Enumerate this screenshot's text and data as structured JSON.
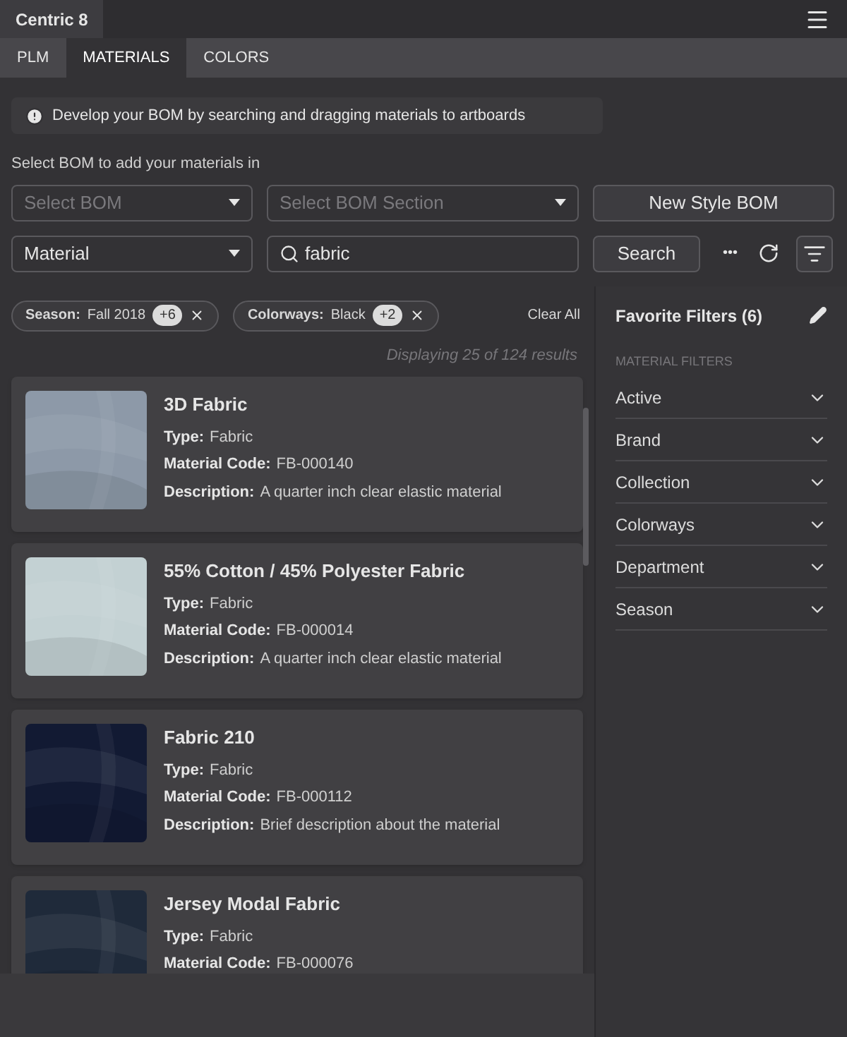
{
  "app": {
    "title": "Centric 8"
  },
  "tabs": [
    {
      "label": "PLM",
      "selected": false
    },
    {
      "label": "MATERIALS",
      "selected": true
    },
    {
      "label": "COLORS",
      "selected": false
    }
  ],
  "notice": "Develop your BOM by searching and dragging materials to artboards",
  "bom_label": "Select BOM to add your materials in",
  "bom_select": {
    "placeholder": "Select BOM"
  },
  "section_select": {
    "placeholder": "Select BOM Section"
  },
  "new_bom_button": "New Style BOM",
  "type_select": {
    "value": "Material"
  },
  "search_field": {
    "value": "fabric"
  },
  "search_button": "Search",
  "more_button": "•••",
  "chips": [
    {
      "label": "Season:",
      "value": "Fall 2018",
      "count": "+6"
    },
    {
      "label": "Colorways:",
      "value": "Black",
      "count": "+2"
    }
  ],
  "clear_all": "Clear All",
  "results_text": "Displaying 25 of 124 results",
  "materials": [
    {
      "name": "3D Fabric",
      "color": "#8d99a8",
      "fields": [
        {
          "label": "Type:",
          "value": "Fabric"
        },
        {
          "label": "Material Code:",
          "value": "FB-000140"
        },
        {
          "label": "Description:",
          "value": "A quarter inch clear elastic material"
        }
      ]
    },
    {
      "name": "55% Cotton / 45% Polyester Fabric",
      "color": "#c3d1d3",
      "fields": [
        {
          "label": "Type:",
          "value": "Fabric"
        },
        {
          "label": "Material Code:",
          "value": "FB-000014"
        },
        {
          "label": "Description:",
          "value": "A quarter inch clear elastic material"
        }
      ]
    },
    {
      "name": "Fabric 210",
      "color": "#121a33",
      "fields": [
        {
          "label": "Type:",
          "value": "Fabric"
        },
        {
          "label": "Material Code:",
          "value": "FB-000112"
        },
        {
          "label": "Description:",
          "value": "Brief description about the material"
        }
      ]
    },
    {
      "name": "Jersey Modal Fabric",
      "color": "#1f2a3a",
      "fields": [
        {
          "label": "Type:",
          "value": "Fabric"
        },
        {
          "label": "Material Code:",
          "value": "FB-000076"
        }
      ]
    }
  ],
  "favorites": {
    "title": "Favorite Filters (6)",
    "section": "MATERIAL FILTERS",
    "filters": [
      {
        "label": "Active",
        "expanded": false
      },
      {
        "label": "Brand",
        "expanded": false
      },
      {
        "label": "Collection",
        "expanded": false
      },
      {
        "label": "Colorways",
        "expanded": false
      },
      {
        "label": "Department",
        "expanded": false
      },
      {
        "label": "Season",
        "expanded": false
      }
    ]
  }
}
